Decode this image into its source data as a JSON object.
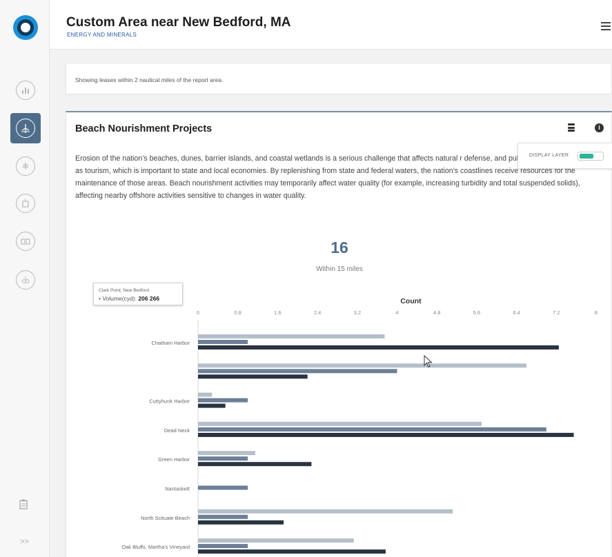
{
  "header": {
    "title": "Custom Area near New Bedford, MA",
    "subtitle": "ENERGY AND MINERALS"
  },
  "sidebar": {
    "items": [
      {
        "name": "chart-icon",
        "active": false
      },
      {
        "name": "wind-energy-icon",
        "active": true
      },
      {
        "name": "natural-resources-icon",
        "active": false
      },
      {
        "name": "transportation-icon",
        "active": false
      },
      {
        "name": "economy-icon",
        "active": false
      },
      {
        "name": "ecology-icon",
        "active": false
      }
    ],
    "bottom": {
      "report_icon": "clipboard-icon",
      "expand_label": ">>"
    }
  },
  "lease_note": "Showing leases within 2 nautical miles of the report area.",
  "section": {
    "title": "Beach Nourishment Projects",
    "description": "Erosion of the nation’s beaches, dunes, barrier islands, and coastal wetlands is a serious challenge that affects natural r defense, and public infrastructure, as well as tourism, which is important to state and local economies. By replenishing from state and federal waters, the nation’s coastlines receive resources for the maintenance of those areas. Beach nourishment activities may temporarily affect water quality (for example, increasing turbidity and total suspended solids), affecting nearby offshore activities sensitive to changes in water quality.",
    "display_layer_label": "DISPLAY LAYER",
    "display_layer_on": true,
    "stat_value": "16",
    "stat_label": "Within 15 miles"
  },
  "tooltip": {
    "location": "Clark Point, New Bedford",
    "metric_label": "Volume(cyd):",
    "metric_value": "206 266"
  },
  "colors": {
    "series1": "#b5bfca",
    "series2": "#6c7f97",
    "series3": "#2a3340",
    "accent": "#4f6d8a",
    "toggle": "#2bb596"
  },
  "chart_data": {
    "type": "bar",
    "orientation": "horizontal",
    "xlabel": "Count",
    "xlim": [
      0,
      8
    ],
    "xticks": [
      "0",
      "0.8",
      "1.6",
      "2.4",
      "3.2",
      "4",
      "4.8",
      "5.6",
      "6.4",
      "7.2",
      "8"
    ],
    "categories": [
      "Chatham Harbor",
      "Clark Point, New Bedford",
      "Cuttyhunk Harbor",
      "Dead Neck",
      "Green Harbor",
      "Nantaskett",
      "North Scituate Beach",
      "Oak Bluffs, Martha's Vineyard"
    ],
    "series": [
      {
        "values": [
          3.75,
          6.6,
          0.28,
          5.7,
          1.15,
          0,
          5.12,
          3.13
        ]
      },
      {
        "values": [
          1.0,
          4.0,
          1.0,
          7.0,
          1.0,
          1.0,
          1.0,
          1.0
        ]
      },
      {
        "values": [
          7.25,
          2.2,
          0.55,
          7.55,
          2.28,
          0,
          1.72,
          3.77
        ]
      }
    ]
  }
}
